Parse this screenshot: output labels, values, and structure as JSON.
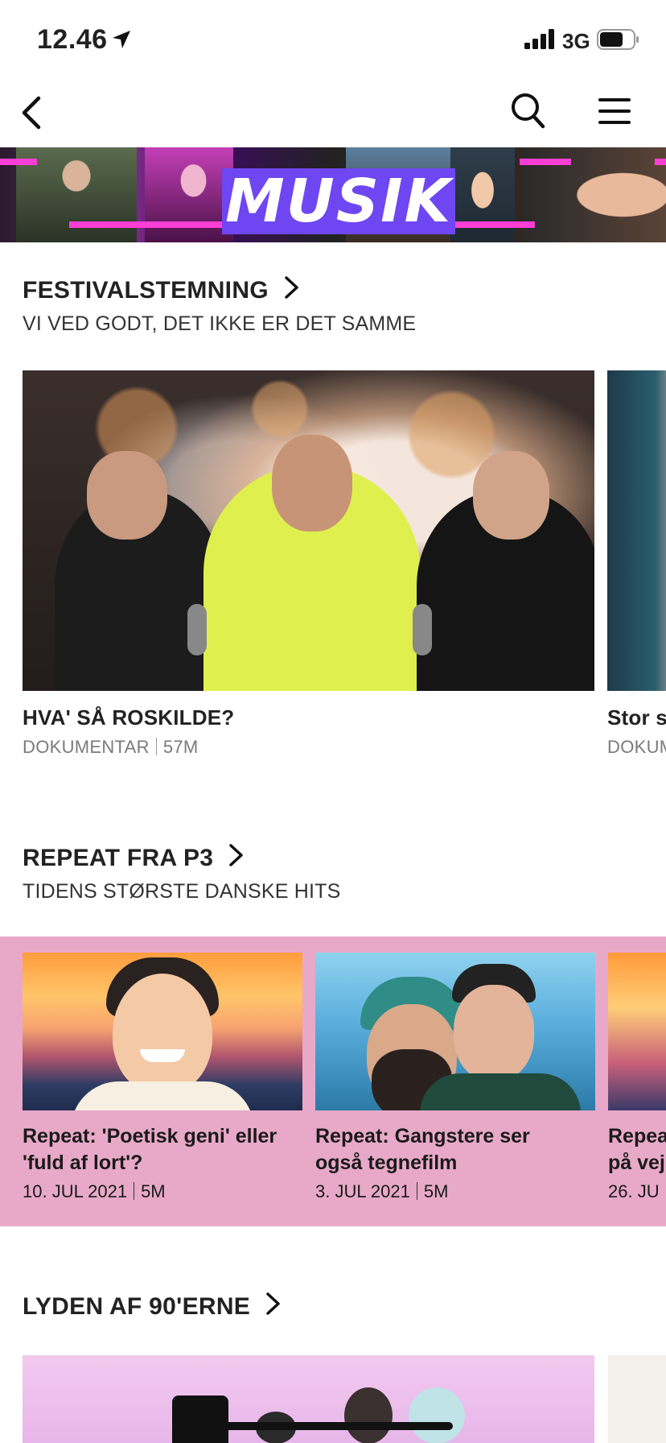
{
  "status_bar": {
    "time": "12.46",
    "network": "3G",
    "icons": [
      "location-arrow-icon",
      "signal-bars-icon",
      "battery-icon"
    ]
  },
  "nav": {
    "icons": [
      "back-chevron-icon",
      "search-icon",
      "hamburger-menu-icon"
    ]
  },
  "banner": {
    "logo_text": "MUSIK",
    "colors": {
      "logo_bg": "#6e46f2",
      "stripe": "#ff3ed6"
    }
  },
  "sections": [
    {
      "title": "FESTIVALSTEMNING",
      "subtitle": "VI VED GODT, DET IKKE ER DET SAMME",
      "cards": [
        {
          "title": "HVA' SÅ ROSKILDE?",
          "category": "DOKUMENTAR",
          "duration": "57M"
        },
        {
          "title": "Stor s",
          "category": "DOKUM"
        }
      ]
    },
    {
      "title": "REPEAT FRA P3",
      "subtitle": "TIDENS STØRSTE DANSKE HITS",
      "background": "#e8a9c9",
      "cards": [
        {
          "title_line1": "Repeat: 'Poetisk geni' eller",
          "title_line2": "'fuld af lort'?",
          "date": "10. JUL 2021",
          "duration": "5M"
        },
        {
          "title_line1": "Repeat: Gangstere ser",
          "title_line2": "også tegnefilm",
          "date": "3. JUL 2021",
          "duration": "5M"
        },
        {
          "title_line1": "Repea",
          "title_line2": "på vej",
          "date": "26. JU"
        }
      ]
    },
    {
      "title": "LYDEN AF 90'ERNE"
    }
  ]
}
